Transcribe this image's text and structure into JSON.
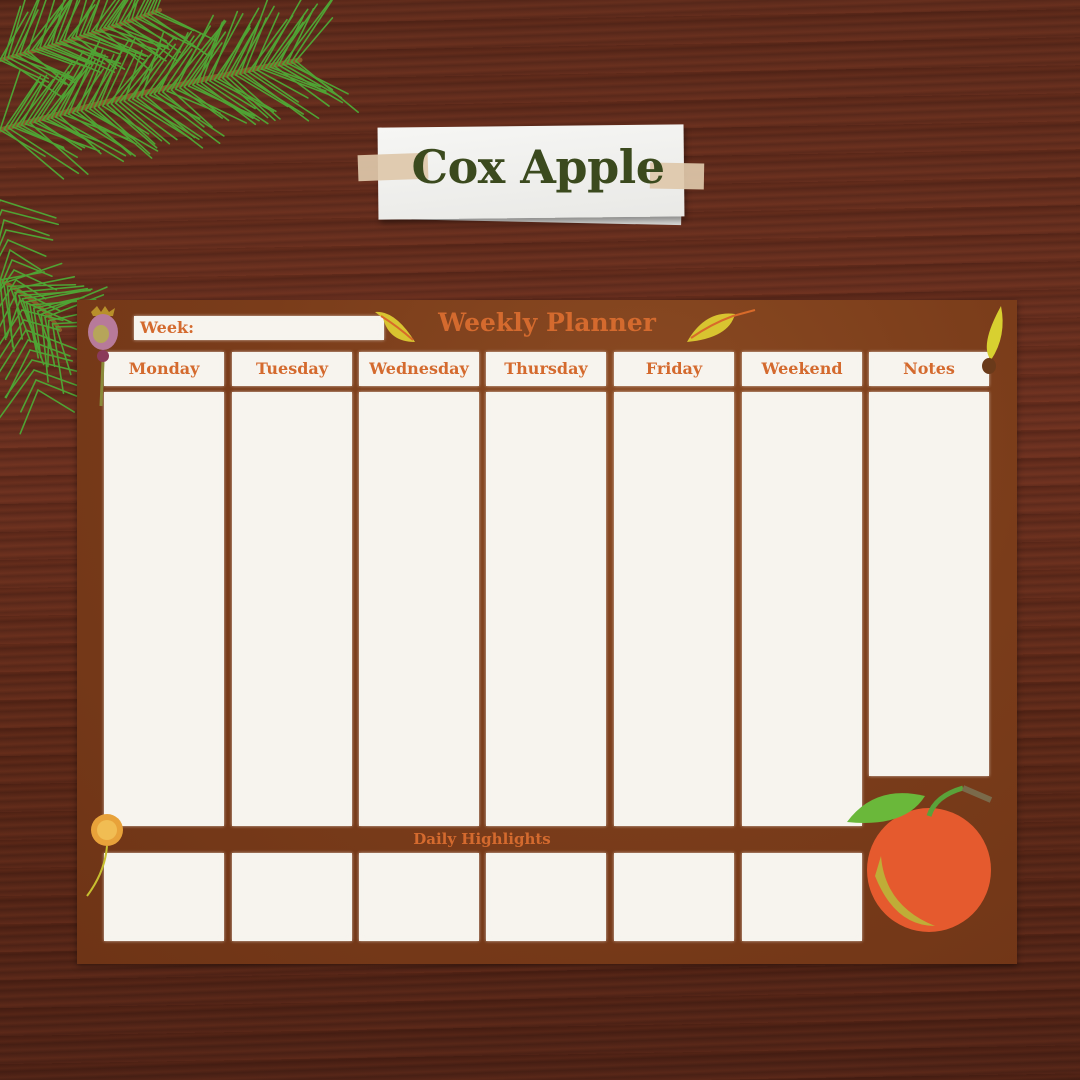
{
  "sticky_note": {
    "title": "Cox Apple"
  },
  "planner": {
    "title": "Weekly Planner",
    "week_label": "Week:",
    "week_value": "",
    "columns": [
      {
        "label": "Monday",
        "content": ""
      },
      {
        "label": "Tuesday",
        "content": ""
      },
      {
        "label": "Wednesday",
        "content": ""
      },
      {
        "label": "Thursday",
        "content": ""
      },
      {
        "label": "Friday",
        "content": ""
      },
      {
        "label": "Weekend",
        "content": ""
      },
      {
        "label": "Notes",
        "content": ""
      }
    ],
    "highlights_label": "Daily Highlights",
    "highlights": [
      "",
      "",
      "",
      "",
      "",
      ""
    ]
  },
  "decorations": [
    "pine-branch",
    "poppy-seed-pod",
    "yellow-leaf",
    "yellow-leaf",
    "maple-seed",
    "dandelion-puff",
    "red-apple"
  ],
  "colors": {
    "accent": "#d46a2e",
    "title_green": "#3b4a1e",
    "board": "#7a3c1a",
    "paper": "#f7f4ee"
  }
}
